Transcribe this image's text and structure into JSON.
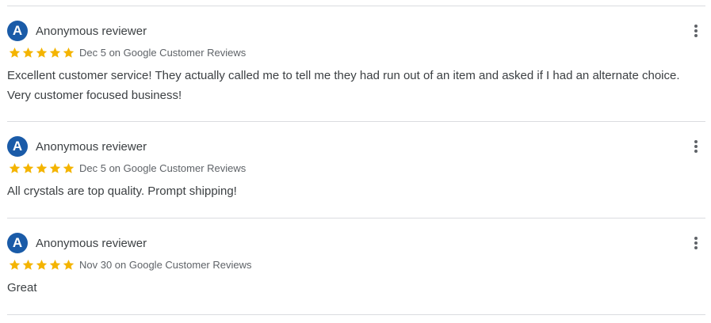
{
  "colors": {
    "avatar_bg": "#1a5ba8",
    "star": "#f4b400",
    "divider": "#dadce0"
  },
  "reviews": [
    {
      "avatar_initial": "A",
      "name": "Anonymous reviewer",
      "rating": 5,
      "meta": "Dec 5 on Google Customer Reviews",
      "text": "Excellent customer service! They actually called me to tell me they had run out of an item and asked if I had an alternate choice. Very customer focused business!",
      "menu_icon": "more-vert-icon"
    },
    {
      "avatar_initial": "A",
      "name": "Anonymous reviewer",
      "rating": 5,
      "meta": "Dec 5 on Google Customer Reviews",
      "text": "All crystals are top quality. Prompt shipping!",
      "menu_icon": "more-vert-icon"
    },
    {
      "avatar_initial": "A",
      "name": "Anonymous reviewer",
      "rating": 5,
      "meta": "Nov 30 on Google Customer Reviews",
      "text": "Great",
      "menu_icon": "more-vert-icon"
    }
  ]
}
